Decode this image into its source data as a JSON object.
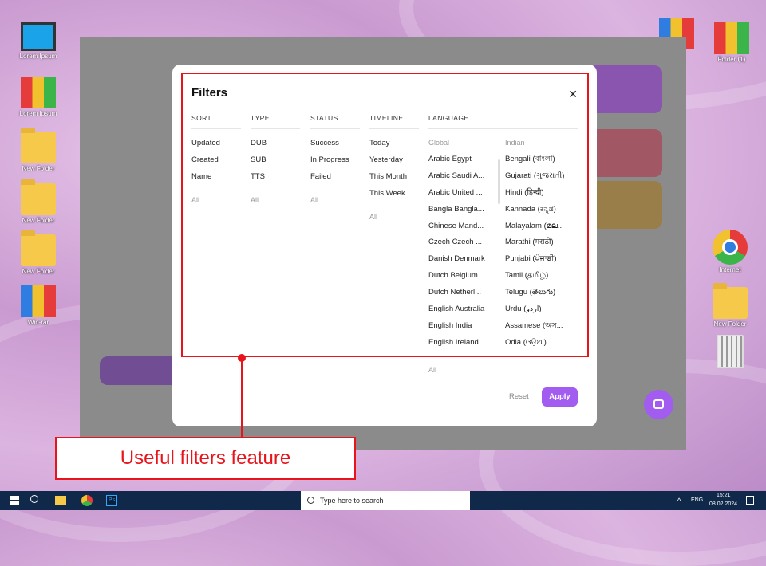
{
  "desktop": {
    "left_icons": [
      "Lorem Ipsum",
      "Lorem Ipsum",
      "New Folder",
      "New Folder",
      "New Folder",
      "Win-rar"
    ],
    "right_icons": [
      "Folder (1)",
      "Internet",
      "New Folder"
    ]
  },
  "modal": {
    "title": "Filters",
    "close_icon": "close-icon",
    "sort": {
      "header": "SORT",
      "items": [
        "Updated",
        "Created",
        "Name"
      ],
      "all": "All"
    },
    "type": {
      "header": "TYPE",
      "items": [
        "DUB",
        "SUB",
        "TTS"
      ],
      "all": "All"
    },
    "status": {
      "header": "STATUS",
      "items": [
        "Success",
        "In Progress",
        "Failed"
      ],
      "all": "All"
    },
    "timeline": {
      "header": "TIMELINE",
      "items": [
        "Today",
        "Yesterday",
        "This Month",
        "This Week"
      ],
      "all": "All"
    },
    "language": {
      "header": "LANGUAGE",
      "global_label": "Global",
      "indian_label": "Indian",
      "global": [
        "Arabic Egypt",
        "Arabic Saudi A...",
        "Arabic United ...",
        "Bangla Bangla...",
        "Chinese Mand...",
        "Czech Czech ...",
        "Danish Denmark",
        "Dutch Belgium",
        "Dutch Netherl...",
        "English Australia",
        "English India",
        "English Ireland"
      ],
      "indian": [
        "Bengali (বাংলা)",
        "Gujarati (ગુજરાતી)",
        "Hindi (हिन्दी)",
        "Kannada (ಕನ್ನಡ)",
        "Malayalam (മല...",
        "Marathi (मराठी)",
        "Punjabi (ਪੰਜਾਬੀ)",
        "Tamil (தமிழ்)",
        "Telugu (తెలుగు)",
        "Urdu (اردو)",
        "Assamese (অস...",
        "Odia (ଓଡ଼ିଆ)"
      ],
      "all": "All"
    },
    "reset": "Reset",
    "apply": "Apply"
  },
  "annotation": "Useful filters feature",
  "taskbar": {
    "search_placeholder": "Type here to search",
    "lang": "ENG",
    "time": "15:21",
    "date": "08.02.2024"
  },
  "colors": {
    "accent": "#a25cf0",
    "annotation": "#e8141b",
    "taskbar": "#10294a"
  }
}
